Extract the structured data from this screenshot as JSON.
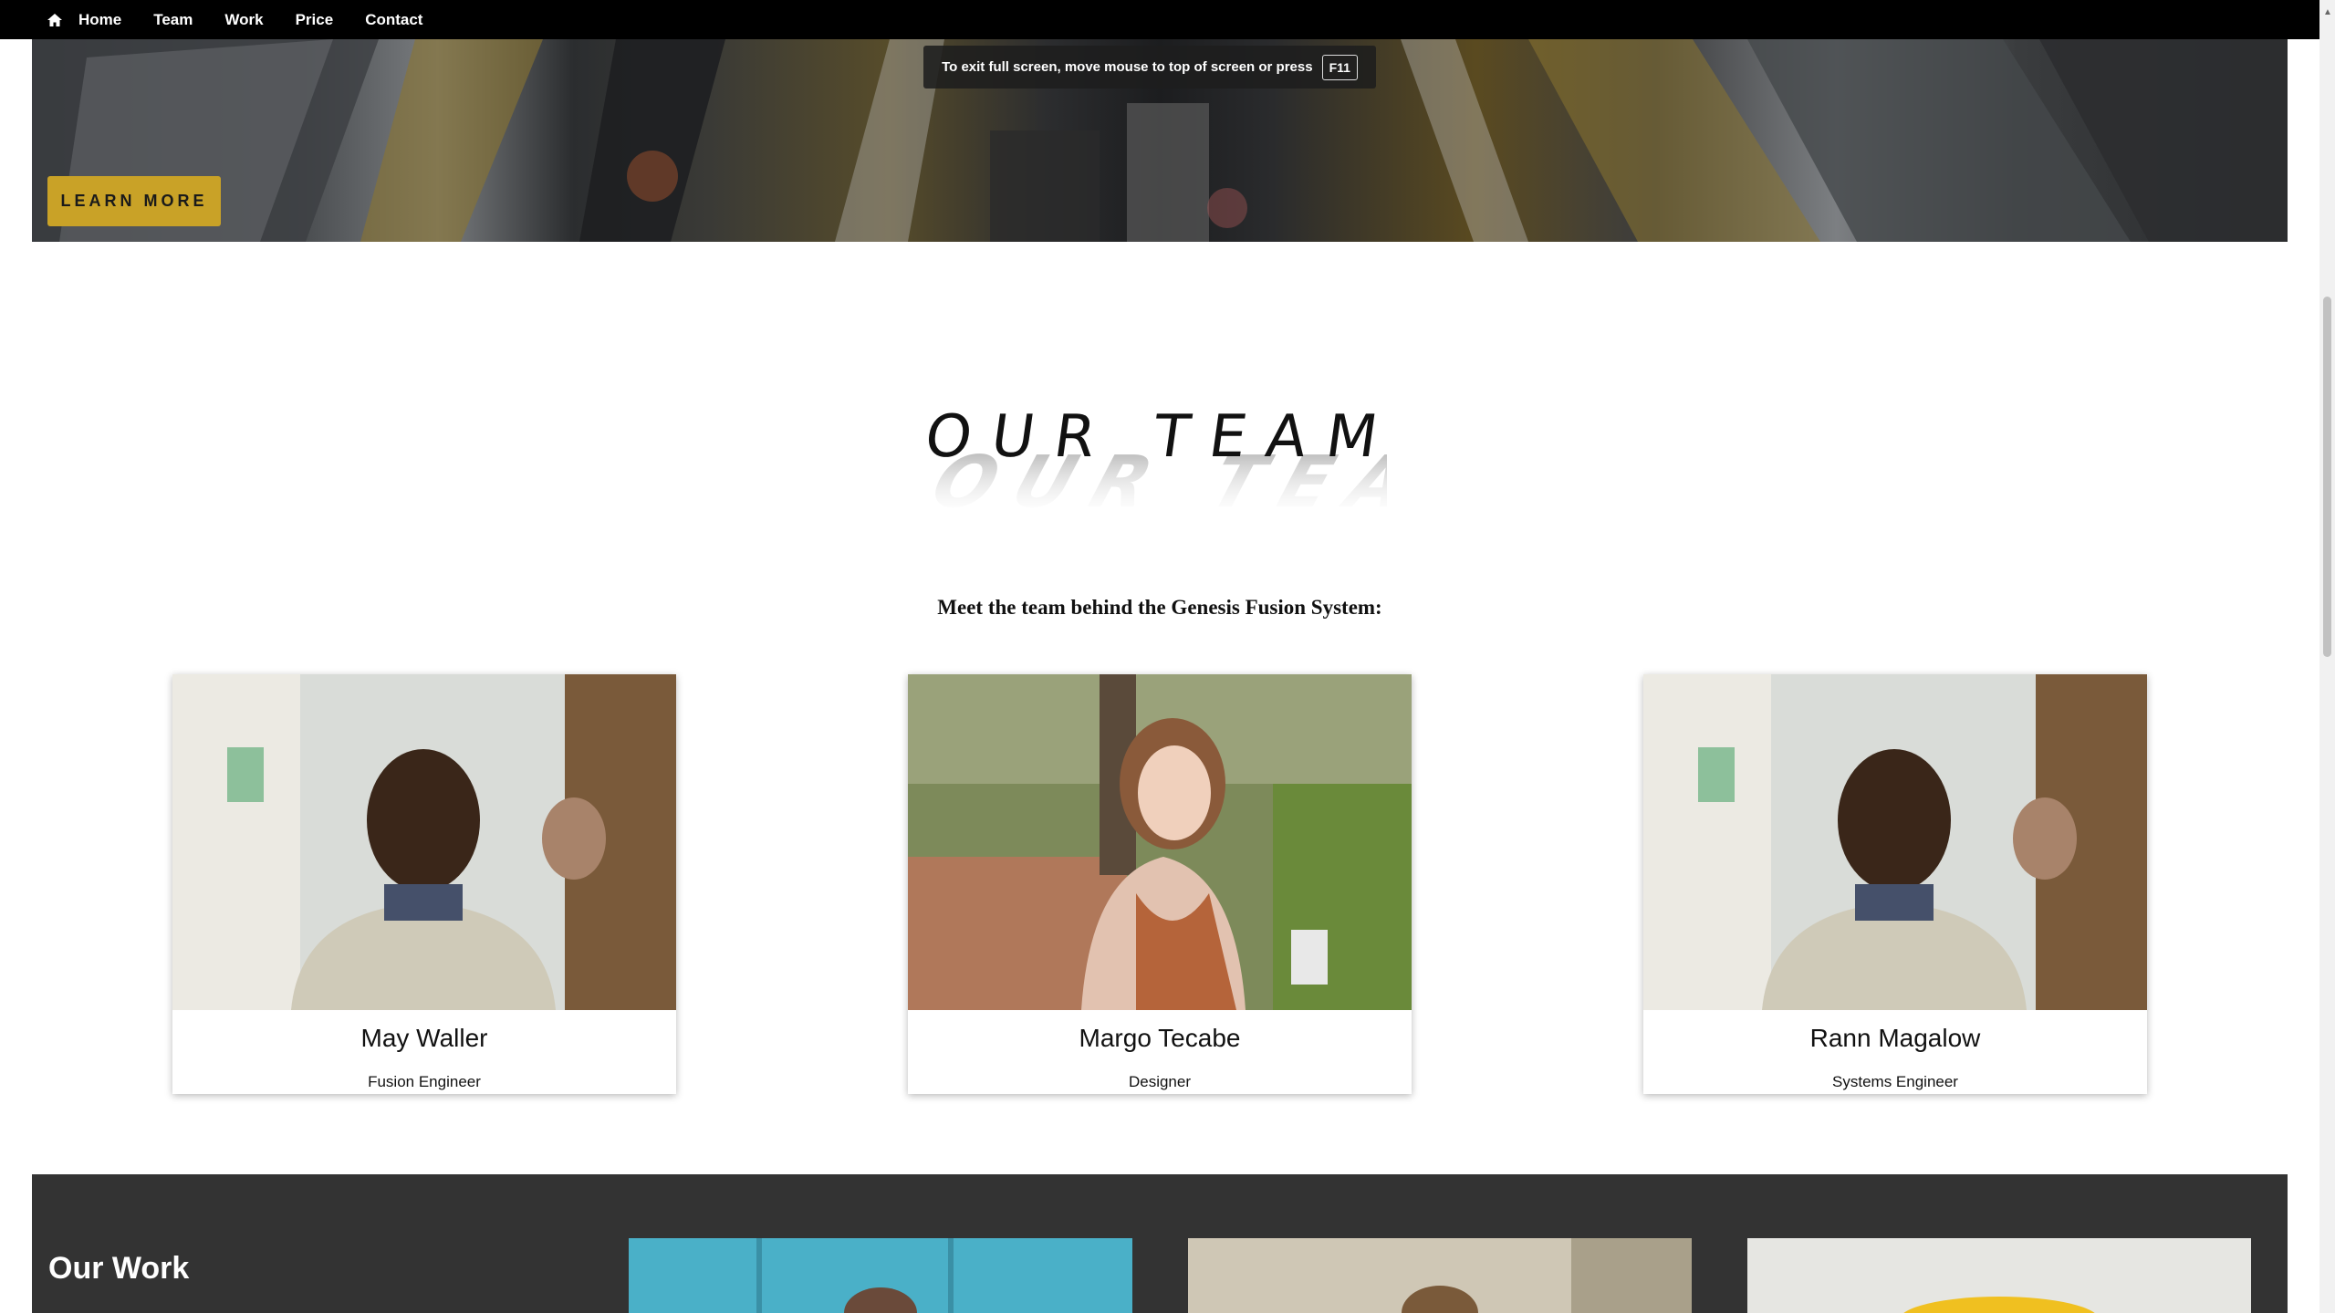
{
  "nav": {
    "items": [
      {
        "label": "Home",
        "icon": "home-icon"
      },
      {
        "label": "Team"
      },
      {
        "label": "Work"
      },
      {
        "label": "Price"
      },
      {
        "label": "Contact"
      }
    ]
  },
  "fullscreen_notice": {
    "text": "To exit full screen, move mouse to top of screen or press",
    "key": "F11"
  },
  "hero": {
    "button_label": "LEARN MORE"
  },
  "team": {
    "title": "OUR TEAM",
    "subtitle": "Meet the team behind the Genesis Fusion System:",
    "members": [
      {
        "name": "May Waller",
        "role": "Fusion Engineer"
      },
      {
        "name": "Margo Tecabe",
        "role": "Designer"
      },
      {
        "name": "Rann Magalow",
        "role": "Systems Engineer"
      }
    ]
  },
  "work": {
    "title": "Our Work"
  },
  "colors": {
    "accent": "#c9a227",
    "nav_bg": "#000000",
    "work_bg": "#333333"
  }
}
